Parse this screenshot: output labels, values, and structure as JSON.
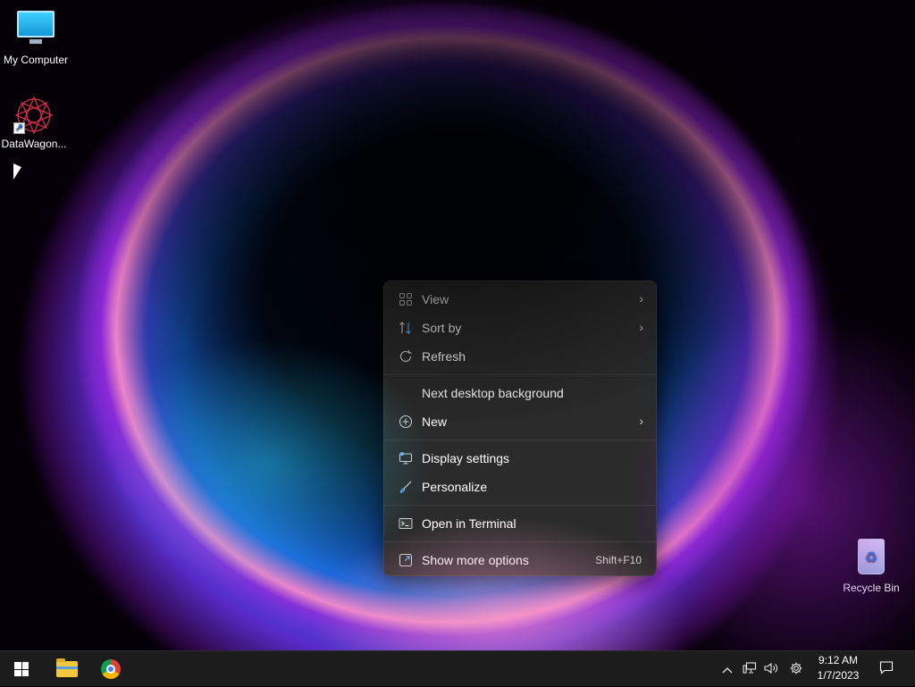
{
  "desktop": {
    "icons": [
      {
        "label": "My Computer"
      },
      {
        "label": "DataWagon..."
      },
      {
        "label": "Recycle Bin"
      }
    ]
  },
  "context_menu": {
    "items": [
      {
        "label": "View",
        "icon": "grid-icon",
        "submenu": true
      },
      {
        "label": "Sort by",
        "icon": "sort-icon",
        "submenu": true
      },
      {
        "label": "Refresh",
        "icon": "refresh-icon"
      },
      {
        "label": "Next desktop background"
      },
      {
        "label": "New",
        "icon": "plus-circle-icon",
        "submenu": true
      },
      {
        "label": "Display settings",
        "icon": "display-icon"
      },
      {
        "label": "Personalize",
        "icon": "brush-icon"
      },
      {
        "label": "Open in Terminal",
        "icon": "terminal-icon"
      },
      {
        "label": "Show more options",
        "icon": "open-external-icon",
        "shortcut": "Shift+F10"
      }
    ]
  },
  "taskbar": {
    "start": "start-icon",
    "pinned": [
      "file-explorer-icon",
      "chrome-icon"
    ],
    "tray_icons": [
      "chevron-up-icon",
      "network-icon",
      "volume-icon",
      "settings-gear-icon"
    ],
    "clock": {
      "time": "9:12 AM",
      "date": "1/7/2023"
    },
    "notifications": "notification-icon"
  },
  "colors": {
    "menu_bg": "#2b2b2b",
    "taskbar_bg": "#1c1c1c"
  }
}
